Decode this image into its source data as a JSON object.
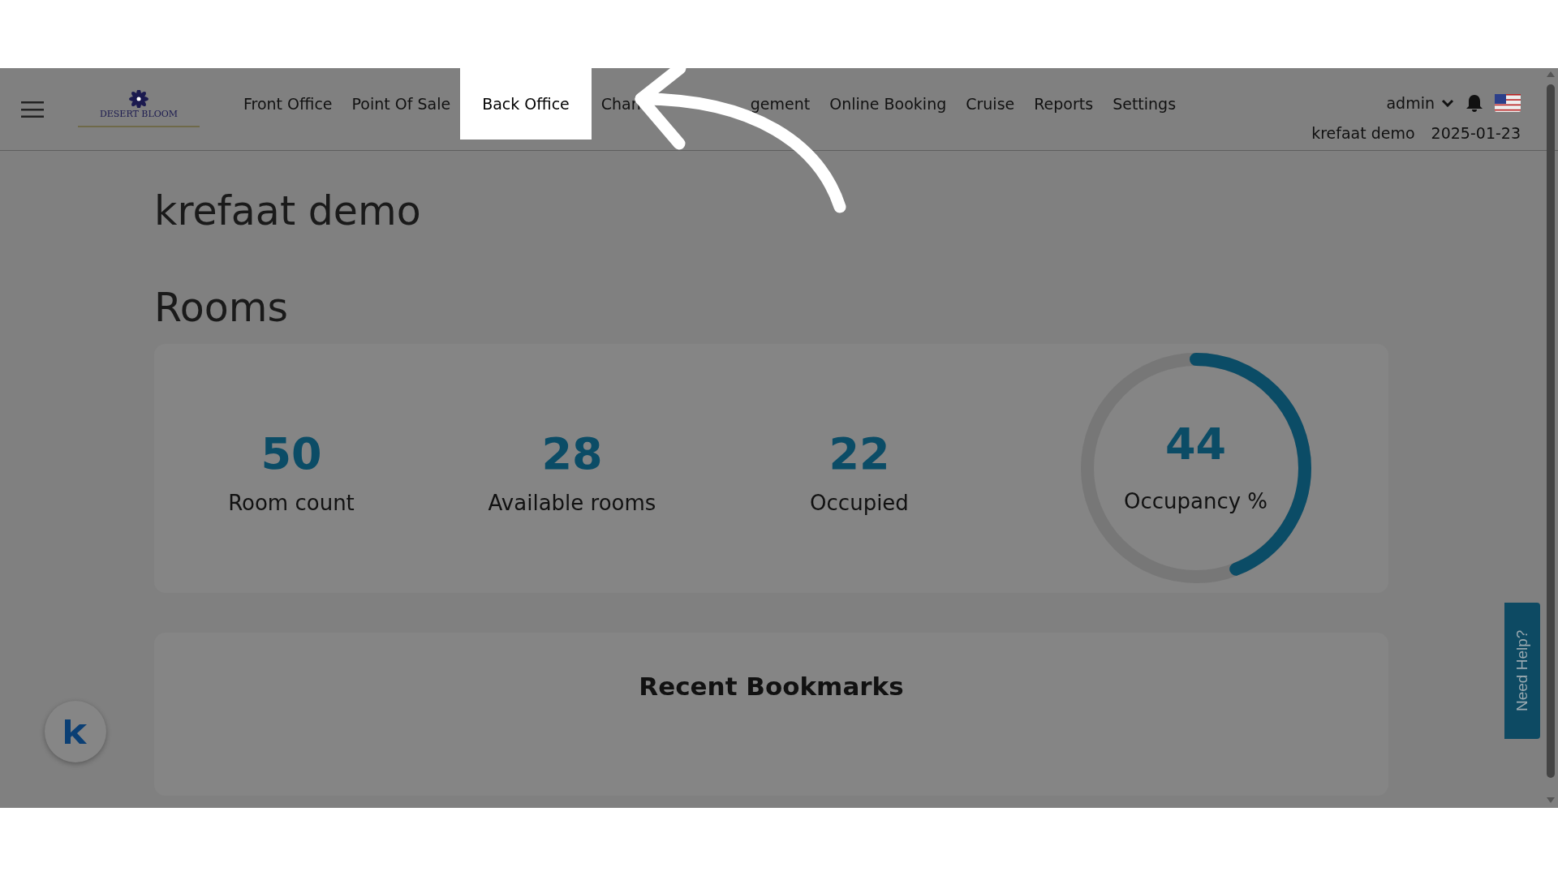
{
  "logo": {
    "text": "DESERT BLOOM"
  },
  "nav": {
    "items": [
      {
        "label": "Front Office",
        "selected": false
      },
      {
        "label": "Point Of Sale",
        "selected": false
      },
      {
        "label": "Back Office",
        "selected": true
      },
      {
        "label": "Chan",
        "label_end": "gement",
        "selected": false
      },
      {
        "label": "Online Booking",
        "selected": false
      },
      {
        "label": "Cruise",
        "selected": false
      },
      {
        "label": "Reports",
        "selected": false
      },
      {
        "label": "Settings",
        "selected": false
      }
    ]
  },
  "user": {
    "name": "admin"
  },
  "property": "krefaat demo",
  "date": "2025-01-23",
  "page_title": "krefaat demo",
  "section_title": "Rooms",
  "stats": [
    {
      "value": "50",
      "label": "Room count"
    },
    {
      "value": "28",
      "label": "Available rooms"
    },
    {
      "value": "22",
      "label": "Occupied"
    }
  ],
  "occupancy": {
    "value": "44",
    "label": "Occupancy %",
    "level": 0.44
  },
  "bookmarks": {
    "title": "Recent Bookmarks"
  },
  "help_tab": {
    "label": "Need Help?"
  }
}
